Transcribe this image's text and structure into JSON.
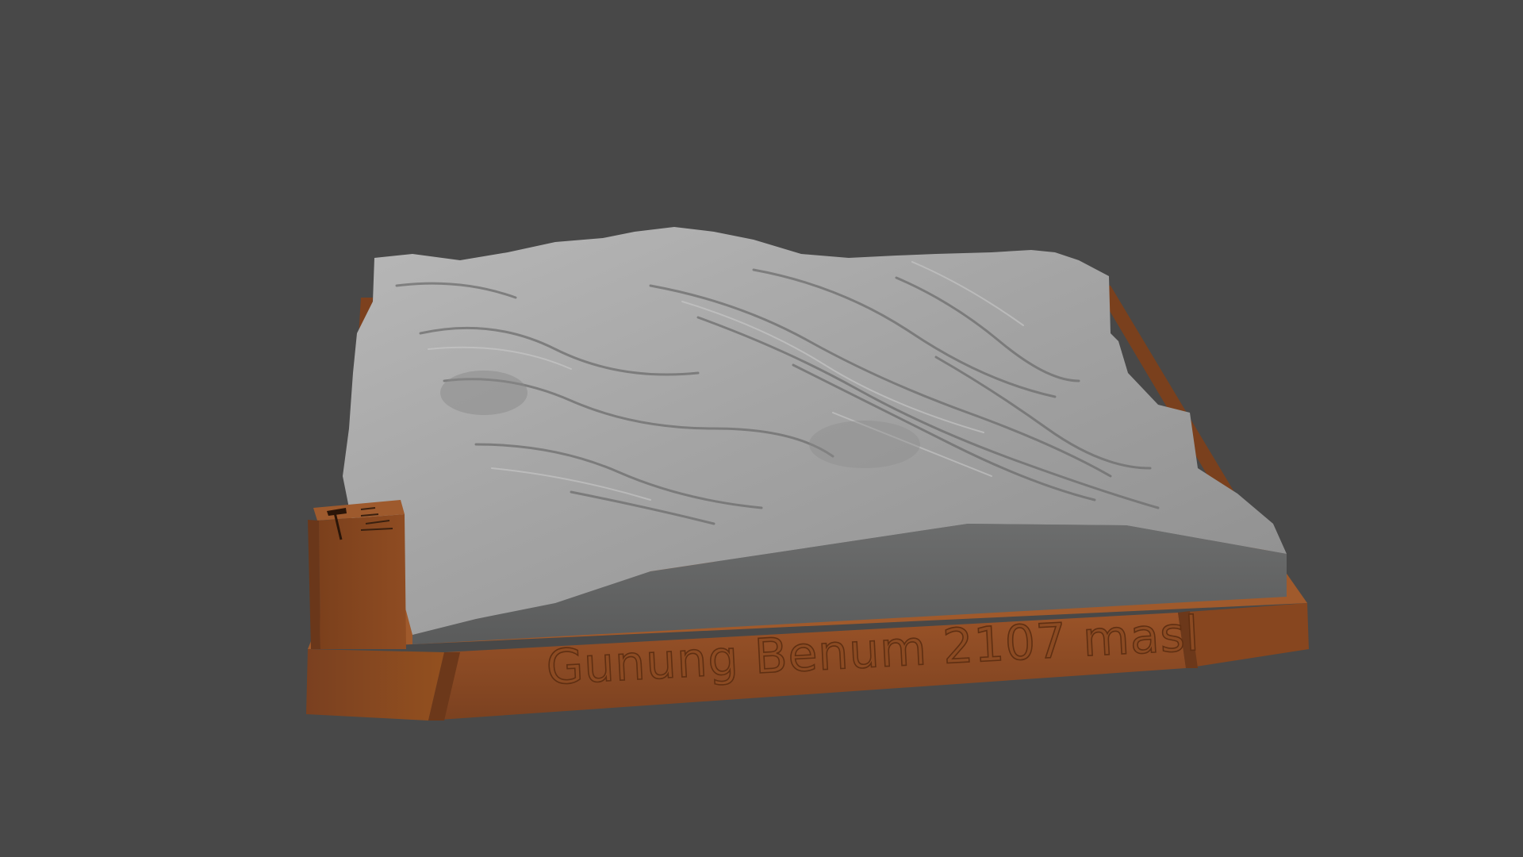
{
  "viewport": {
    "background_color": "#484848"
  },
  "model": {
    "base_label": "Gunung Benum 2107 masl",
    "terrain_color": "#a8a8a8",
    "terrain_side_color": "#5f6060",
    "base_color": "#8f4d24",
    "base_shadow_color": "#6a3a1c",
    "tower_icons": [
      "hammer-icon",
      "legend-icon"
    ]
  }
}
